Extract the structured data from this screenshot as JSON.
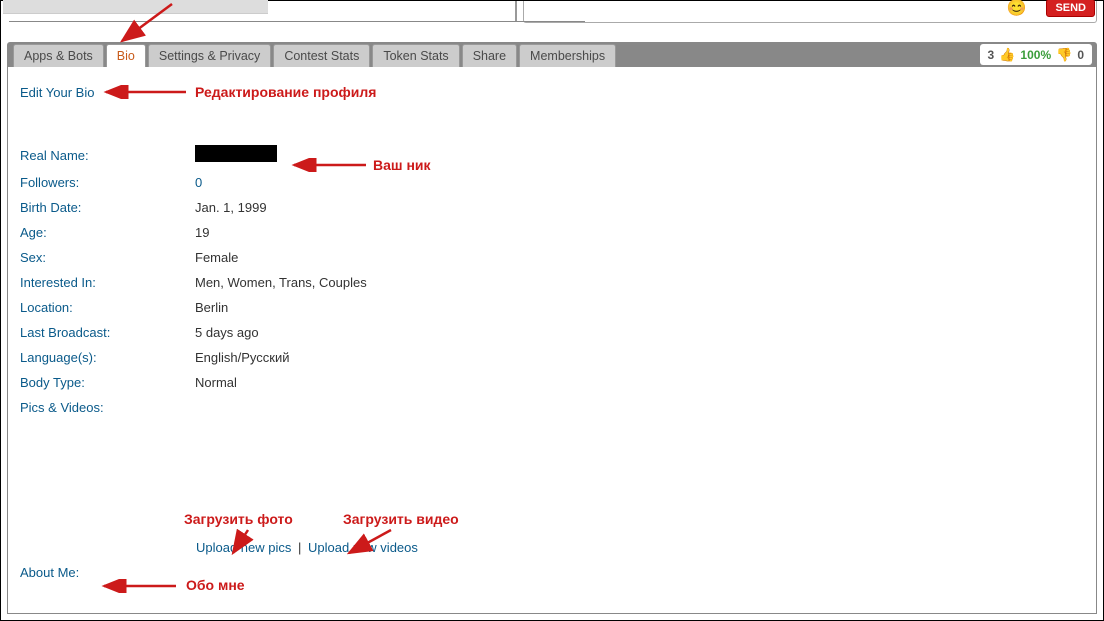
{
  "topbar": {
    "send_label": "SEND"
  },
  "tabs": {
    "apps_bots": "Apps & Bots",
    "bio": "Bio",
    "settings": "Settings & Privacy",
    "contest": "Contest Stats",
    "token": "Token Stats",
    "share": "Share",
    "memberships": "Memberships"
  },
  "rating": {
    "up_count": "3",
    "percent": "100%",
    "down_count": "0"
  },
  "panel": {
    "edit_link": "Edit Your Bio"
  },
  "bio": {
    "labels": {
      "real_name": "Real Name:",
      "followers": "Followers:",
      "birth_date": "Birth Date:",
      "age": "Age:",
      "sex": "Sex:",
      "interested": "Interested In:",
      "location": "Location:",
      "last_broadcast": "Last Broadcast:",
      "languages": "Language(s):",
      "body_type": "Body Type:",
      "pics_videos": "Pics & Videos:",
      "about_me": "About Me:"
    },
    "values": {
      "followers": "0",
      "birth_date": "Jan. 1, 1999",
      "age": "19",
      "sex": "Female",
      "interested": "Men, Women, Trans, Couples",
      "location": "Berlin",
      "last_broadcast": "5 days ago",
      "languages": "English/Русский",
      "body_type": "Normal"
    }
  },
  "uploads": {
    "pics": "Upload new pics",
    "sep": "|",
    "videos": "Upload new videos"
  },
  "annotations": {
    "edit_profile": "Редактирование профиля",
    "your_nick": "Ваш ник",
    "upload_photo": "Загрузить фото",
    "upload_video": "Загрузить видео",
    "about_me": "Обо мне"
  }
}
